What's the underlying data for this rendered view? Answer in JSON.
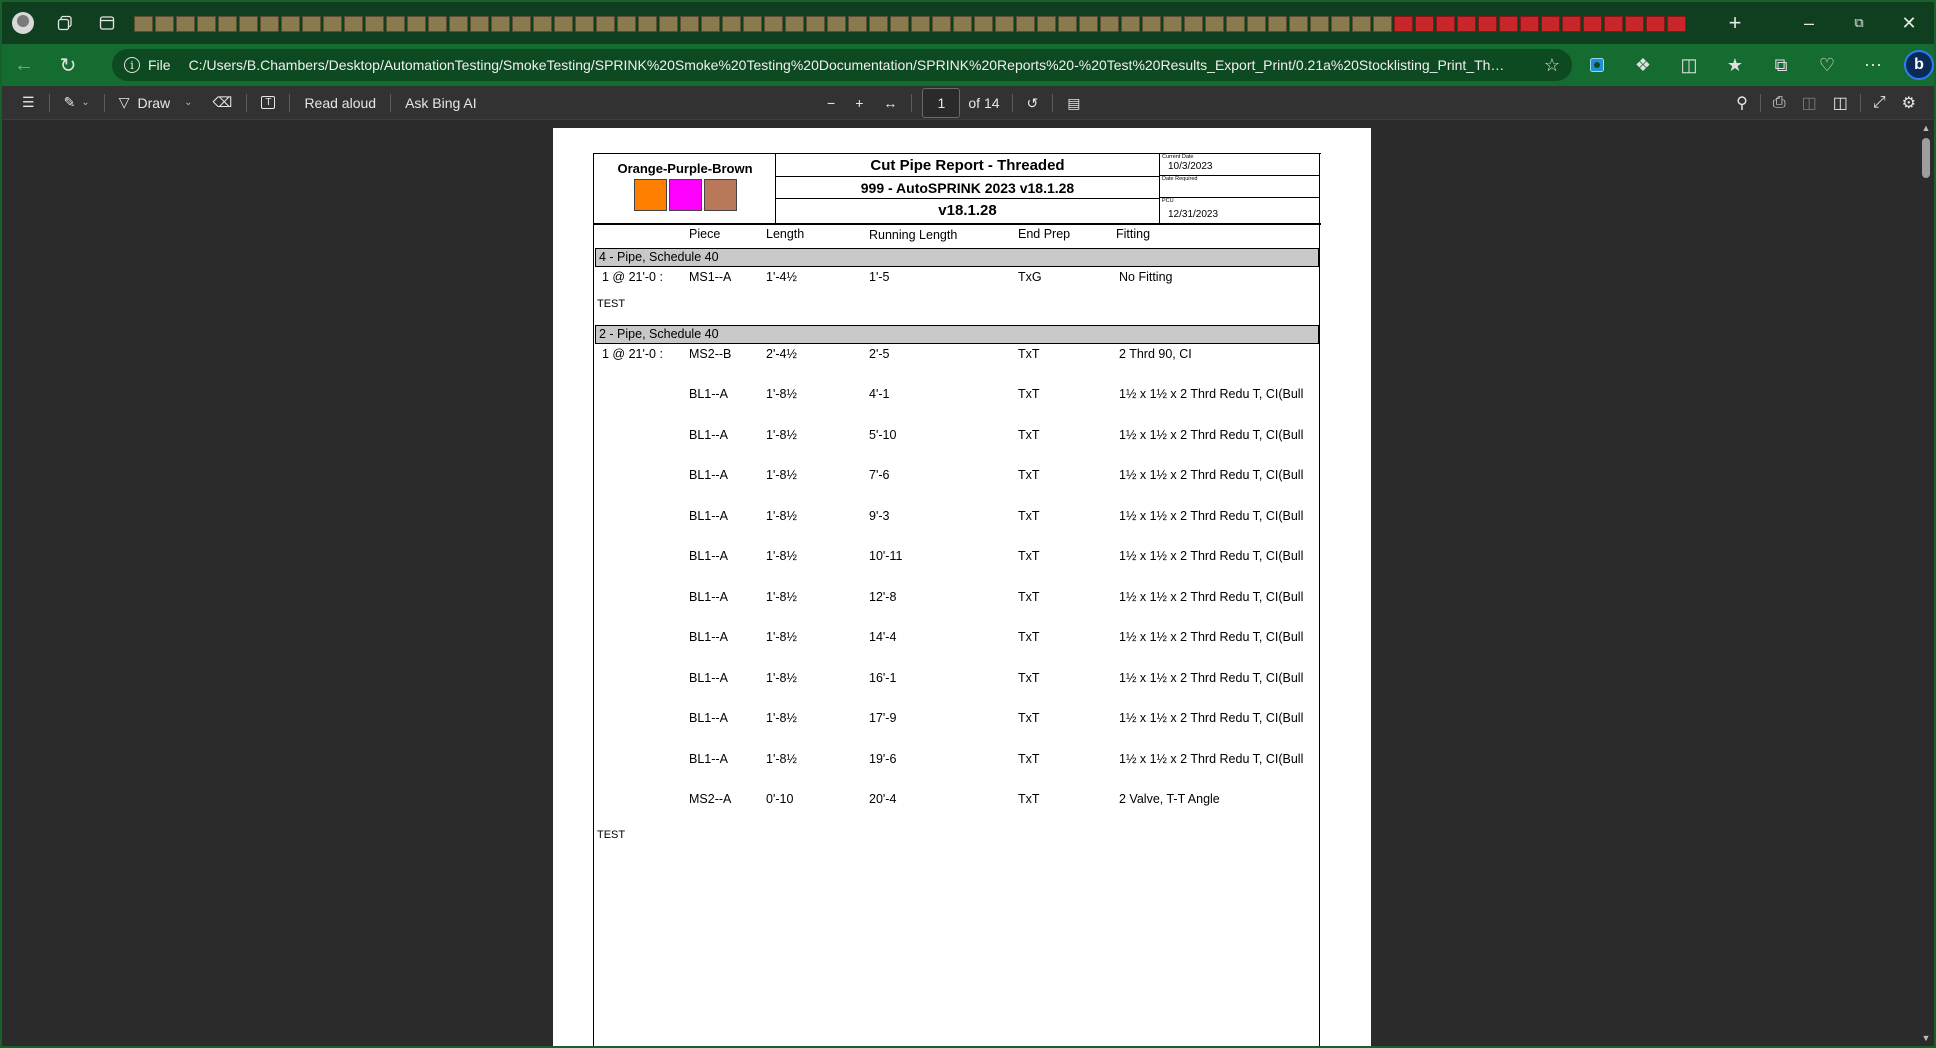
{
  "browser": {
    "address": {
      "scheme": "File",
      "url": "C:/Users/B.Chambers/Desktop/AutomationTesting/SmokeTesting/SPRINK%20Smoke%20Testing%20Documentation/SPRINK%20Reports%20-%20Test%20Results_Export_Print/0.21a%20Stocklisting_Print_ThreadedC..."
    }
  },
  "pdf_toolbar": {
    "draw_label": "Draw",
    "read_aloud_label": "Read aloud",
    "ask_bing_label": "Ask Bing AI",
    "page_number": "1",
    "page_total": "of 14"
  },
  "report": {
    "job_name": "Orange-Purple-Brown",
    "swatch_colors": [
      "#ff8000",
      "#ff00ff",
      "#b9785a"
    ],
    "title": "Cut Pipe Report - Threaded",
    "subtitle": "999 - AutoSPRINK 2023 v18.1.28",
    "version": "v18.1.28",
    "current_date_label": "Current Date",
    "current_date": "10/3/2023",
    "date_required_label": "Date Required",
    "date_required": "",
    "pcu_label": "PCU",
    "pcu_date": "12/31/2023",
    "columns": {
      "piece": "Piece",
      "length": "Length",
      "running_length": "Running Length",
      "end_prep": "End Prep",
      "fitting": "Fitting"
    },
    "sections": [
      {
        "header": "4 - Pipe, Schedule 40",
        "qty": "1 @ 21'-0 :",
        "rows": [
          {
            "piece": "MS1--A",
            "length": "1'-4½",
            "running": "1'-5",
            "prep": "TxG",
            "fitting": "No Fitting"
          }
        ],
        "note": "TEST"
      },
      {
        "header": "2 - Pipe, Schedule 40",
        "qty": "1 @ 21'-0 :",
        "rows": [
          {
            "piece": "MS2--B",
            "length": "2'-4½",
            "running": "2'-5",
            "prep": "TxT",
            "fitting": "2 Thrd 90, CI"
          },
          {
            "piece": "BL1--A",
            "length": "1'-8½",
            "running": "4'-1",
            "prep": "TxT",
            "fitting": "1½ x 1½ x 2 Thrd Redu T, CI(Bull"
          },
          {
            "piece": "BL1--A",
            "length": "1'-8½",
            "running": "5'-10",
            "prep": "TxT",
            "fitting": "1½ x 1½ x 2 Thrd Redu T, CI(Bull"
          },
          {
            "piece": "BL1--A",
            "length": "1'-8½",
            "running": "7'-6",
            "prep": "TxT",
            "fitting": "1½ x 1½ x 2 Thrd Redu T, CI(Bull"
          },
          {
            "piece": "BL1--A",
            "length": "1'-8½",
            "running": "9'-3",
            "prep": "TxT",
            "fitting": "1½ x 1½ x 2 Thrd Redu T, CI(Bull"
          },
          {
            "piece": "BL1--A",
            "length": "1'-8½",
            "running": "10'-11",
            "prep": "TxT",
            "fitting": "1½ x 1½ x 2 Thrd Redu T, CI(Bull"
          },
          {
            "piece": "BL1--A",
            "length": "1'-8½",
            "running": "12'-8",
            "prep": "TxT",
            "fitting": "1½ x 1½ x 2 Thrd Redu T, CI(Bull"
          },
          {
            "piece": "BL1--A",
            "length": "1'-8½",
            "running": "14'-4",
            "prep": "TxT",
            "fitting": "1½ x 1½ x 2 Thrd Redu T, CI(Bull"
          },
          {
            "piece": "BL1--A",
            "length": "1'-8½",
            "running": "16'-1",
            "prep": "TxT",
            "fitting": "1½ x 1½ x 2 Thrd Redu T, CI(Bull"
          },
          {
            "piece": "BL1--A",
            "length": "1'-8½",
            "running": "17'-9",
            "prep": "TxT",
            "fitting": "1½ x 1½ x 2 Thrd Redu T, CI(Bull"
          },
          {
            "piece": "BL1--A",
            "length": "1'-8½",
            "running": "19'-6",
            "prep": "TxT",
            "fitting": "1½ x 1½ x 2 Thrd Redu T, CI(Bull"
          },
          {
            "piece": "MS2--A",
            "length": "0'-10",
            "running": "20'-4",
            "prep": "TxT",
            "fitting": "2 Valve, T-T Angle"
          }
        ],
        "note": "TEST"
      }
    ]
  }
}
